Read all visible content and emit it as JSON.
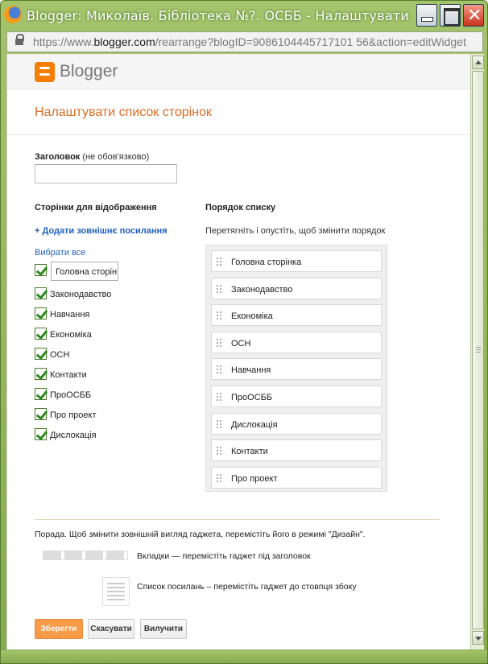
{
  "window": {
    "title": "Blogger: Миколаїв. Бібліотека №?. ОСББ - Налаштувати сп...",
    "url_prefix": "https://www.",
    "url_host": "blogger.com",
    "url_rest": "/rearrange?blogID=9086104445717101 56&action=editWidget"
  },
  "header": {
    "brand": "Blogger"
  },
  "page_title": "Налаштувати список сторінок",
  "title_field": {
    "label_bold": "Заголовок",
    "label_hint": " (не обов'язково)",
    "value": ""
  },
  "pages_section": {
    "heading": "Сторінки для відображення",
    "add_external_link": "+ Додати зовнішнє посилання",
    "select_all": "Вибрати все",
    "items": [
      {
        "label": "Головна сторін",
        "editing": true
      },
      {
        "label": "Законодавство"
      },
      {
        "label": "Навчання"
      },
      {
        "label": "Економіка"
      },
      {
        "label": "ОСН"
      },
      {
        "label": "Контакти"
      },
      {
        "label": "ПроОСББ"
      },
      {
        "label": "Про проект"
      },
      {
        "label": "Дислокація"
      }
    ]
  },
  "order_section": {
    "heading": "Порядок списку",
    "hint": "Перетягніть і опустіть, щоб змінити порядок",
    "items": [
      "Головна сторінка",
      "Законодавство",
      "Економіка",
      "ОСН",
      "Навчання",
      "ПроОСББ",
      "Дислокація",
      "Контакти",
      "Про проект"
    ]
  },
  "tips": {
    "main": "Порада. Щоб змінити зовнішній вигляд гаджета, перемістіть його в режимі \"Дизайн\".",
    "tabs": "Вкладки — перемістіть гаджет під заголовок",
    "list": "Список посилань – перемістіть гаджет до стовпця збоку"
  },
  "buttons": {
    "save": "Зберегти",
    "cancel": "Скасувати",
    "delete": "Вилучити"
  },
  "colors": {
    "accent": "#dd6c23",
    "link": "#1f5fc0",
    "save_button": "#f89b49"
  }
}
